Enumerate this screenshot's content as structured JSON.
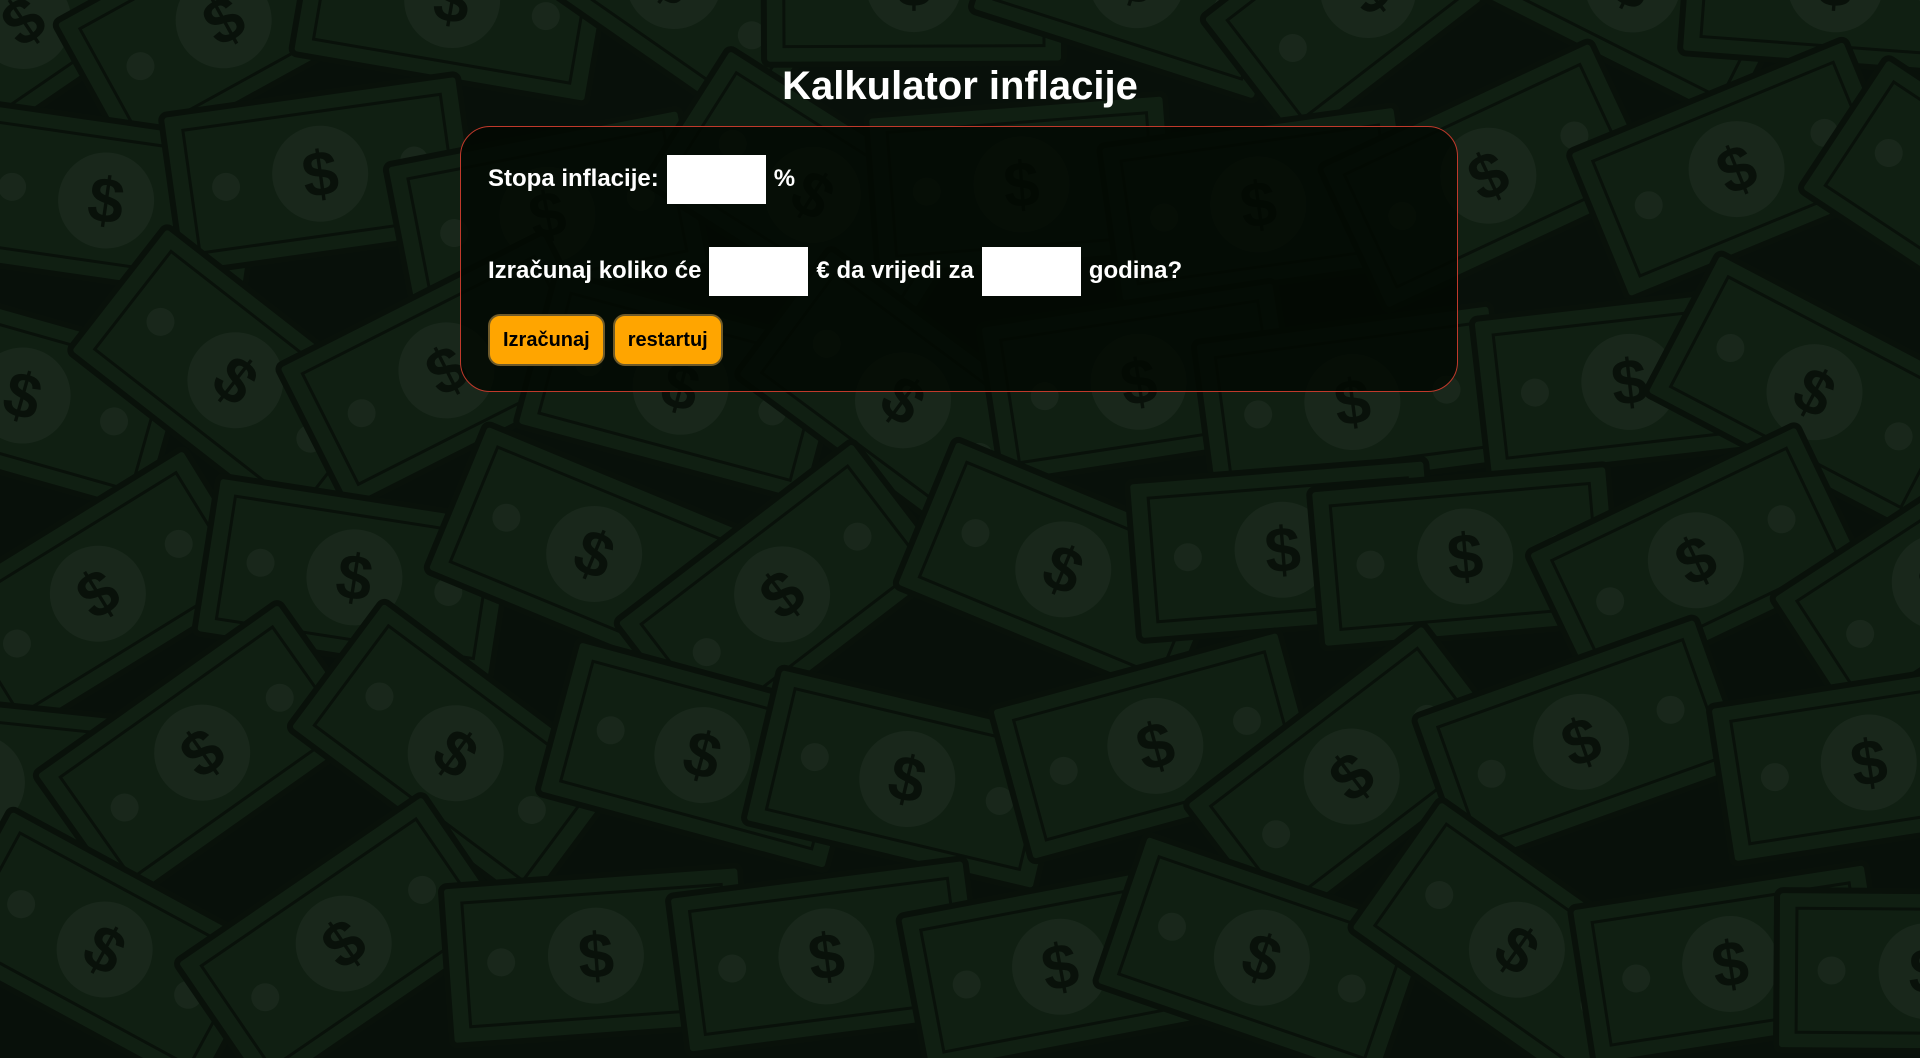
{
  "page": {
    "title": "Kalkulator inflacije"
  },
  "form": {
    "rate_label": "Stopa inflacije:",
    "rate_value": "",
    "rate_unit": "%",
    "amount_prefix": "Izračunaj koliko će",
    "amount_value": "",
    "amount_suffix": "€ da vrijedi za",
    "years_value": "",
    "years_suffix": "godina?"
  },
  "buttons": {
    "calculate_label": "Izračunaj",
    "reset_label": "restartuj"
  },
  "colors": {
    "background": "#0c140d",
    "bill": "#1b301d",
    "card_border": "#c0392b",
    "button": "#ffa500"
  }
}
